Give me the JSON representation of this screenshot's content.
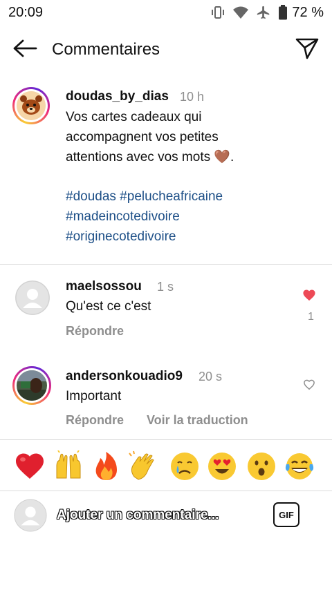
{
  "status_bar": {
    "time": "20:09",
    "battery": "72 %",
    "icons": [
      "vibrate-icon",
      "wifi-icon",
      "airplane-icon",
      "battery-icon"
    ]
  },
  "header": {
    "title": "Commentaires",
    "back_icon": "arrow-left-icon",
    "share_icon": "paper-plane-icon"
  },
  "post": {
    "username": "doudas_by_dias",
    "time": "10 h",
    "caption_lines": [
      "Vos cartes cadeaux qui",
      "accompagnent vos petites",
      "attentions avec vos mots 🤎."
    ],
    "hashtags": [
      "#doudas #pelucheafricaine",
      "#madeincotedivoire",
      "#originecotedivoire"
    ]
  },
  "comments": [
    {
      "username": "maelsossou",
      "time": "1 s",
      "text": "Qu'est ce c'est",
      "reply_label": "Répondre",
      "liked": true,
      "like_count": "1"
    },
    {
      "username": "andersonkouadio9",
      "time": "20 s",
      "text": "Important",
      "reply_label": "Répondre",
      "translate_label": "Voir la traduction",
      "liked": false
    }
  ],
  "emoji_bar": [
    "❤️",
    "🙌",
    "🔥",
    "👏",
    "😢",
    "😍",
    "😮",
    "😂"
  ],
  "composer": {
    "placeholder": "Ajouter un commentaire...",
    "gif_label": "GIF"
  },
  "colors": {
    "like_red": "#ed4956",
    "hashtag_blue": "#1d4f87",
    "secondary_gray": "#8e8e8e"
  }
}
